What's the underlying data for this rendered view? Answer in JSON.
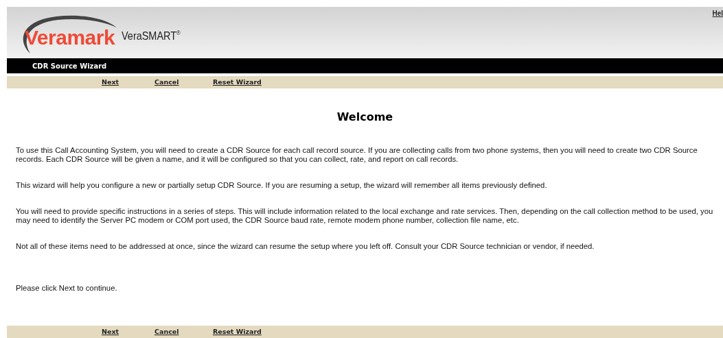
{
  "header": {
    "logo": "Veramark",
    "product": "VeraSMART$^{®}$",
    "help_link": "Hel"
  },
  "title_bar": {
    "title": "CDR Source Wizard"
  },
  "top_nav": [
    {
      "label": "Next"
    },
    {
      "label": "Cancel"
    },
    {
      "label": "Reset Wizard"
    }
  ],
  "heading": "Welcome",
  "paragraphs": [
    "To use this Call Accounting System, you will need to create a CDR Source for each call record source. If you are collecting calls from two phone systems, then you will need to create two CDR Source records. Each CDR Source will be given a name, and it will be configured so that you can collect, rate, and report on call records.",
    "This wizard will help you configure a new or partially setup CDR Source. If you are resuming a setup, the wizard will remember all items previously defined.",
    "You will need to provide specific instructions in a series of steps. This will include information related to the local exchange and rate services. Then, depending on the call collection method to be used, you may need to identify the Server PC modem or COM port used, the CDR Source baud rate, remote modem phone number, collection file name, etc.",
    "Not all of these items need to be addressed at once, since the wizard can resume the setup where you left off. Consult your CDR Source technician or vendor, if needed."
  ],
  "closing": "Please click Next to continue.",
  "bottom_nav": [
    {
      "label": "Next"
    },
    {
      "label": "Cancel"
    },
    {
      "label": "Reset Wizard"
    }
  ]
}
